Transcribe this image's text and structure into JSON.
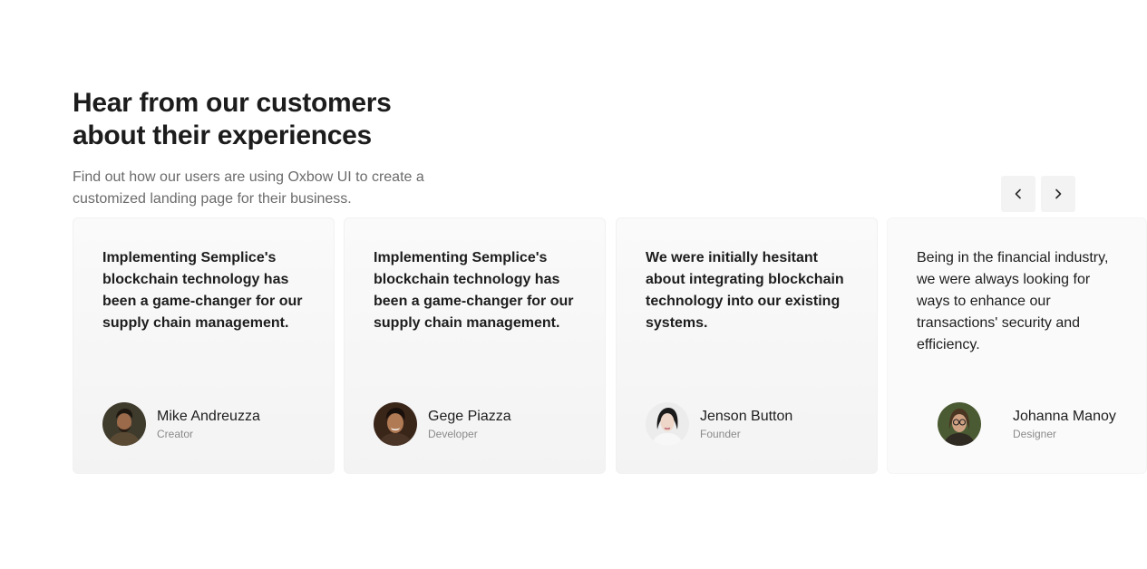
{
  "section": {
    "title": "Hear from our customers\nabout their experiences",
    "subtitle": "Find out how our users are using Oxbow UI to create a\ncustomized landing page for their business."
  },
  "carousel": {
    "prev_icon": "chevron-left-icon",
    "next_icon": "chevron-right-icon",
    "icon_color": "#2b2b2b",
    "button_bg": "#f3f3f3"
  },
  "testimonials": [
    {
      "quote": "Implementing Semplice's blockchain technology has been a game-changer for our supply chain management.",
      "name": "Mike Andreuzza",
      "role": "Creator"
    },
    {
      "quote": "Implementing Semplice's blockchain technology has been a game-changer for our supply chain management.",
      "name": "Gege Piazza",
      "role": "Developer"
    },
    {
      "quote": "We were initially hesitant about integrating blockchain technology into our existing systems.",
      "name": "Jenson Button",
      "role": "Founder"
    },
    {
      "quote": "Being in the financial industry, we were always looking for ways to enhance our transactions' security and efficiency.",
      "name": "Johanna Manoy",
      "role": "Designer"
    }
  ]
}
